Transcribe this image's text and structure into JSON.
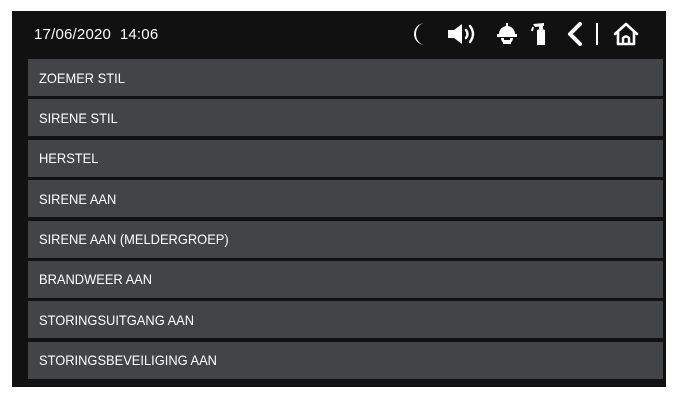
{
  "status_bar": {
    "date": "17/06/2020",
    "time": "14:06",
    "icons": [
      "night-mode-moon-icon",
      "speaker-volume-icon",
      "firefighter-helmet-icon",
      "fire-extinguisher-icon",
      "back-chevron-icon",
      "home-icon"
    ]
  },
  "menu": {
    "items": [
      {
        "label": "ZOEMER STIL"
      },
      {
        "label": "SIRENE STIL"
      },
      {
        "label": "HERSTEL"
      },
      {
        "label": "SIRENE AAN"
      },
      {
        "label": "SIRENE AAN (MELDERGROEP)"
      },
      {
        "label": "BRANDWEER AAN"
      },
      {
        "label": "STORINGSUITGANG AAN"
      },
      {
        "label": "STORINGSBEVEILIGING AAN"
      }
    ]
  },
  "colors": {
    "screen_background": "#111111",
    "menu_item_background": "#424445",
    "text": "#ffffff"
  }
}
